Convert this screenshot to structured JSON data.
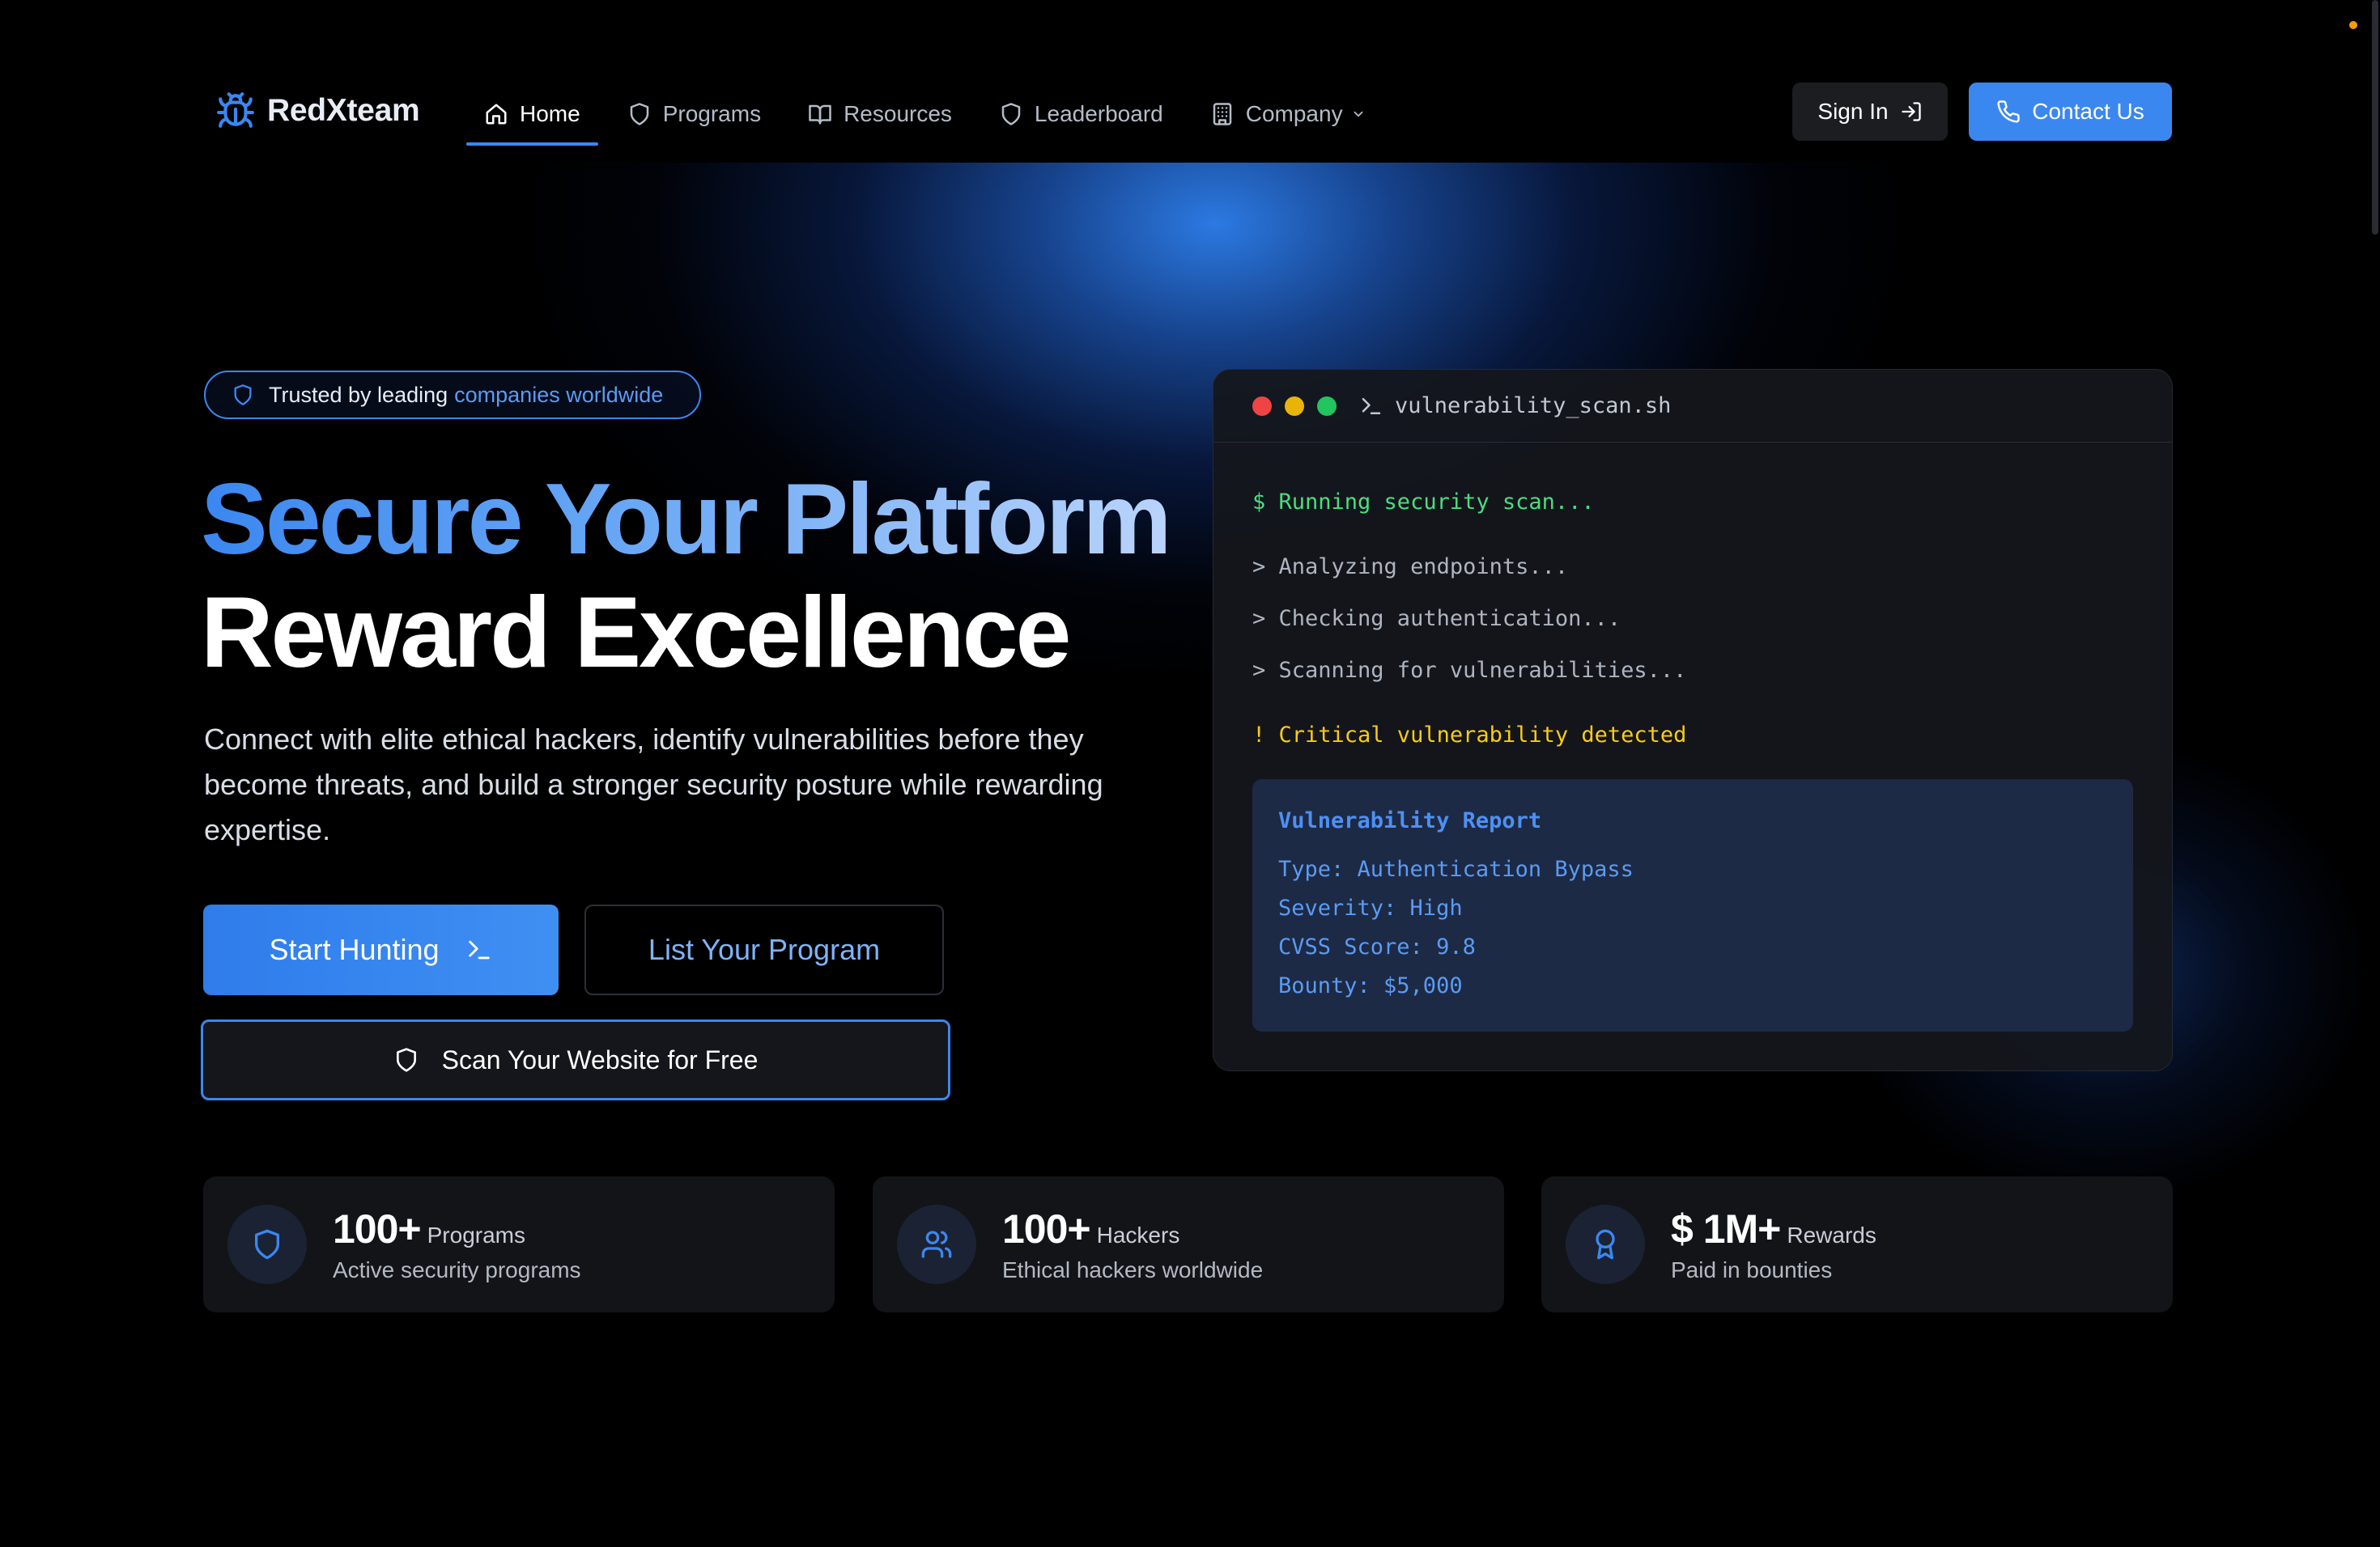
{
  "brand": {
    "name": "RedXteam"
  },
  "nav": {
    "items": [
      {
        "label": "Home",
        "icon": "home-icon",
        "active": true
      },
      {
        "label": "Programs",
        "icon": "shield-icon"
      },
      {
        "label": "Resources",
        "icon": "book-icon"
      },
      {
        "label": "Leaderboard",
        "icon": "shield-icon"
      },
      {
        "label": "Company",
        "icon": "building-icon",
        "dropdown": true
      }
    ],
    "sign_in": "Sign In",
    "contact": "Contact Us"
  },
  "hero": {
    "trust_prefix": "Trusted by leading",
    "trust_highlight": "companies worldwide",
    "title_line1": "Secure Your Platform",
    "title_line2": "Reward Excellence",
    "lead": "Connect with elite ethical hackers, identify vulnerabilities before they become threats, and build a stronger security posture while rewarding expertise.",
    "start_hunting": "Start Hunting",
    "list_program": "List Your Program",
    "scan_website": "Scan Your Website for Free"
  },
  "terminal": {
    "title": "vulnerability_scan.sh",
    "line_running": "$ Running security scan...",
    "line_analyzing": "> Analyzing endpoints...",
    "line_checking": "> Checking authentication...",
    "line_scanning": "> Scanning for vulnerabilities...",
    "line_critical": "! Critical vulnerability detected",
    "report": {
      "title": "Vulnerability Report",
      "type": "Type: Authentication Bypass",
      "severity": "Severity: High",
      "cvss": "CVSS Score: 9.8",
      "bounty": "Bounty: $5,000"
    }
  },
  "stats": [
    {
      "value": "100+",
      "unit": "Programs",
      "desc": "Active security programs",
      "icon": "shield-icon"
    },
    {
      "value": "100+",
      "unit": "Hackers",
      "desc": "Ethical hackers worldwide",
      "icon": "users-icon"
    },
    {
      "value": "$ 1M+",
      "unit": "Rewards",
      "desc": "Paid in bounties",
      "icon": "award-icon"
    }
  ],
  "colors": {
    "accent": "#3b87f0",
    "green": "#4ade80",
    "yellow": "#facc15",
    "red_dot": "#ef4444",
    "yellow_dot": "#eab308",
    "green_dot": "#22c55e"
  }
}
